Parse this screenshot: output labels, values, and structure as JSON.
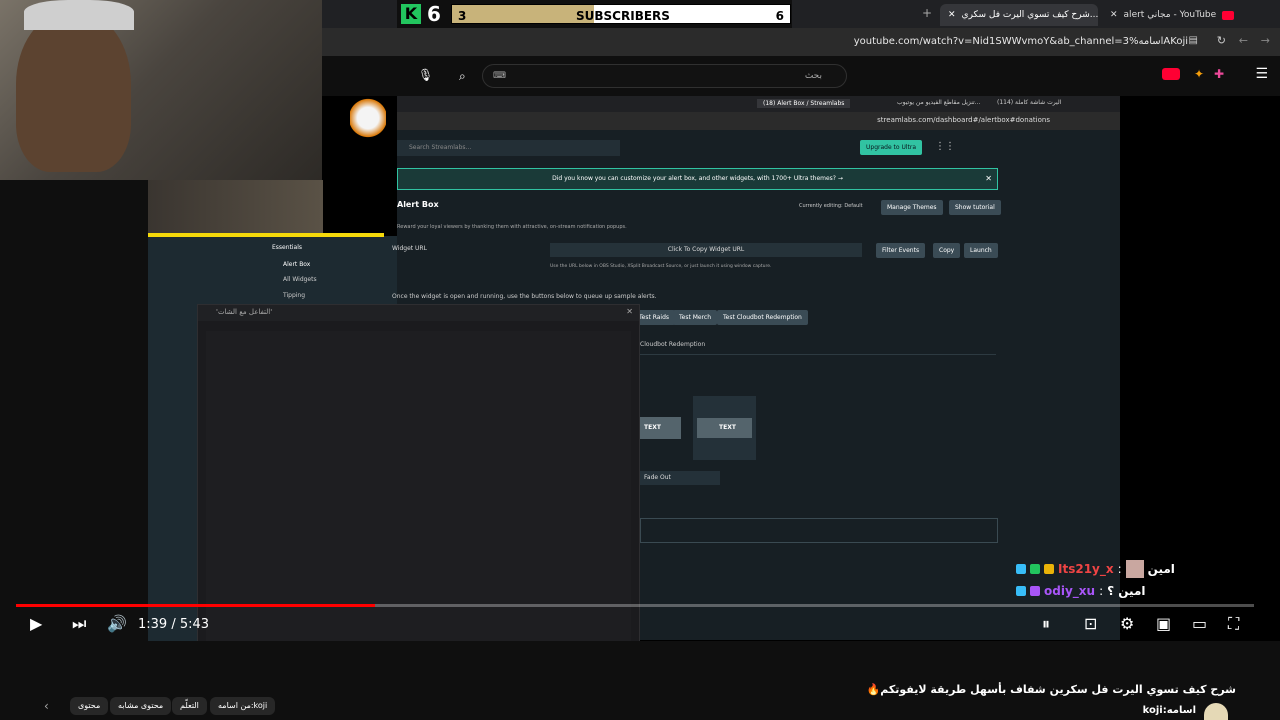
{
  "browser": {
    "tabs": [
      {
        "label": "alert مجاني - YouTube"
      },
      {
        "label": "شرح كيف تسوي اليرت فل سكري..."
      }
    ],
    "url": "youtube.com/watch?v=Nid1SWWvmoY&ab_channel=3%اسامهAKoji"
  },
  "youtube": {
    "search_placeholder": "بحث",
    "video_title": "شرح كيف تسوي اليرت فل سكرين شفاف بأسهل طريقة لايفوتكم🔥",
    "channel": "koji:اسامه",
    "chips": [
      "محتوى مشابه",
      "التعلّم",
      "من اسامه:koji",
      "محتوى"
    ]
  },
  "player": {
    "time_current": "1:39",
    "time_total": "5:43",
    "progress": 0.29
  },
  "overlay": {
    "goal_current": "3",
    "goal_label": "SUBSCRIBERS",
    "goal_target": "6",
    "goal_fraction": 0.42,
    "koji_count": "6",
    "chat_title": "'التفاعل مع الشات'",
    "chat": [
      {
        "user": "Its21y_x",
        "message": "امين",
        "color": "#ef4444"
      },
      {
        "user": "odiy_xu",
        "message": "امين ؟",
        "color": "#a855f7"
      }
    ]
  },
  "streamlabs": {
    "inner_tabs": [
      "(18) Alert Box / Streamlabs",
      "(114) اليرت شاشة كاملة",
      "تنزيل مقاطع الفيديو من يوتيوب..."
    ],
    "inner_url": "streamlabs.com/dashboard#/alertbox#donations",
    "search": "Search Streamlabs...",
    "upgrade": "Upgrade to Ultra",
    "banner": "Did you know you can customize your alert box, and other widgets, with 1700+ Ultra themes? →",
    "page_title": "Alert Box",
    "page_desc": "Reward your loyal viewers by thanking them with attractive, on-stream notification popups.",
    "editing": "Currently editing: Default",
    "manage_themes": "Manage Themes",
    "show_tutorial": "Show tutorial",
    "widget_url_label": "Widget URL",
    "copy_widget": "Click To Copy Widget URL",
    "filter_events": "Filter Events",
    "copy": "Copy",
    "launch": "Launch",
    "hint": "Use the URL below in OBS Studio, XSplit Broadcast Source, or just launch it using window capture.",
    "queue": "Once the widget is open and running, use the buttons below to queue up sample alerts.",
    "test_raids": "Test Raids",
    "test_merch": "Test Merch",
    "test_cloudbot": "Test Cloudbot Redemption",
    "cloudbot_tab": "Cloudbot Redemption",
    "text1": "TEXT",
    "text2": "TEXT",
    "fade": "Fade Out",
    "sidebar": [
      "Essentials",
      "Alert Box",
      "All Widgets",
      "Tipping"
    ]
  }
}
